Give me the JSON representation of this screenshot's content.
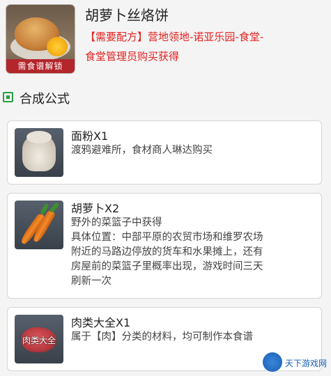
{
  "recipe": {
    "title": "胡萝卜丝烙饼",
    "icon": "bread-pastry-icon",
    "ribbon": "需食谱解锁",
    "requirement_line1": "【需要配方】营地领地-诺亚乐园-食堂-",
    "requirement_line2": "食堂管理员购买获得",
    "requirement_color": "#e1211f"
  },
  "section": {
    "title": "合成公式",
    "icon": "green-square-icon",
    "accent": "#2a9d3f"
  },
  "ingredients": [
    {
      "name": "面粉X1",
      "icon": "flour-sack-icon",
      "lines": [
        "渡鸦避难所，食材商人琳达购买"
      ]
    },
    {
      "name": "胡萝卜X2",
      "icon": "carrot-icon",
      "lines": [
        "野外的菜篮子中获得",
        "具体位置：中部平原的农贸市场和维罗农场",
        "附近的马路边停放的货车和水果摊上，还有",
        "房屋前的菜篮子里概率出现，游戏时间三天",
        "刷新一次"
      ]
    },
    {
      "name": "肉类大全X1",
      "icon": "meat-icon",
      "thumb_label": "肉类大全",
      "lines": [
        "属于【肉】分类的材料，均可制作本食谱"
      ]
    }
  ],
  "watermark": {
    "text": "天下游戏网",
    "icon": "site-logo-icon"
  }
}
